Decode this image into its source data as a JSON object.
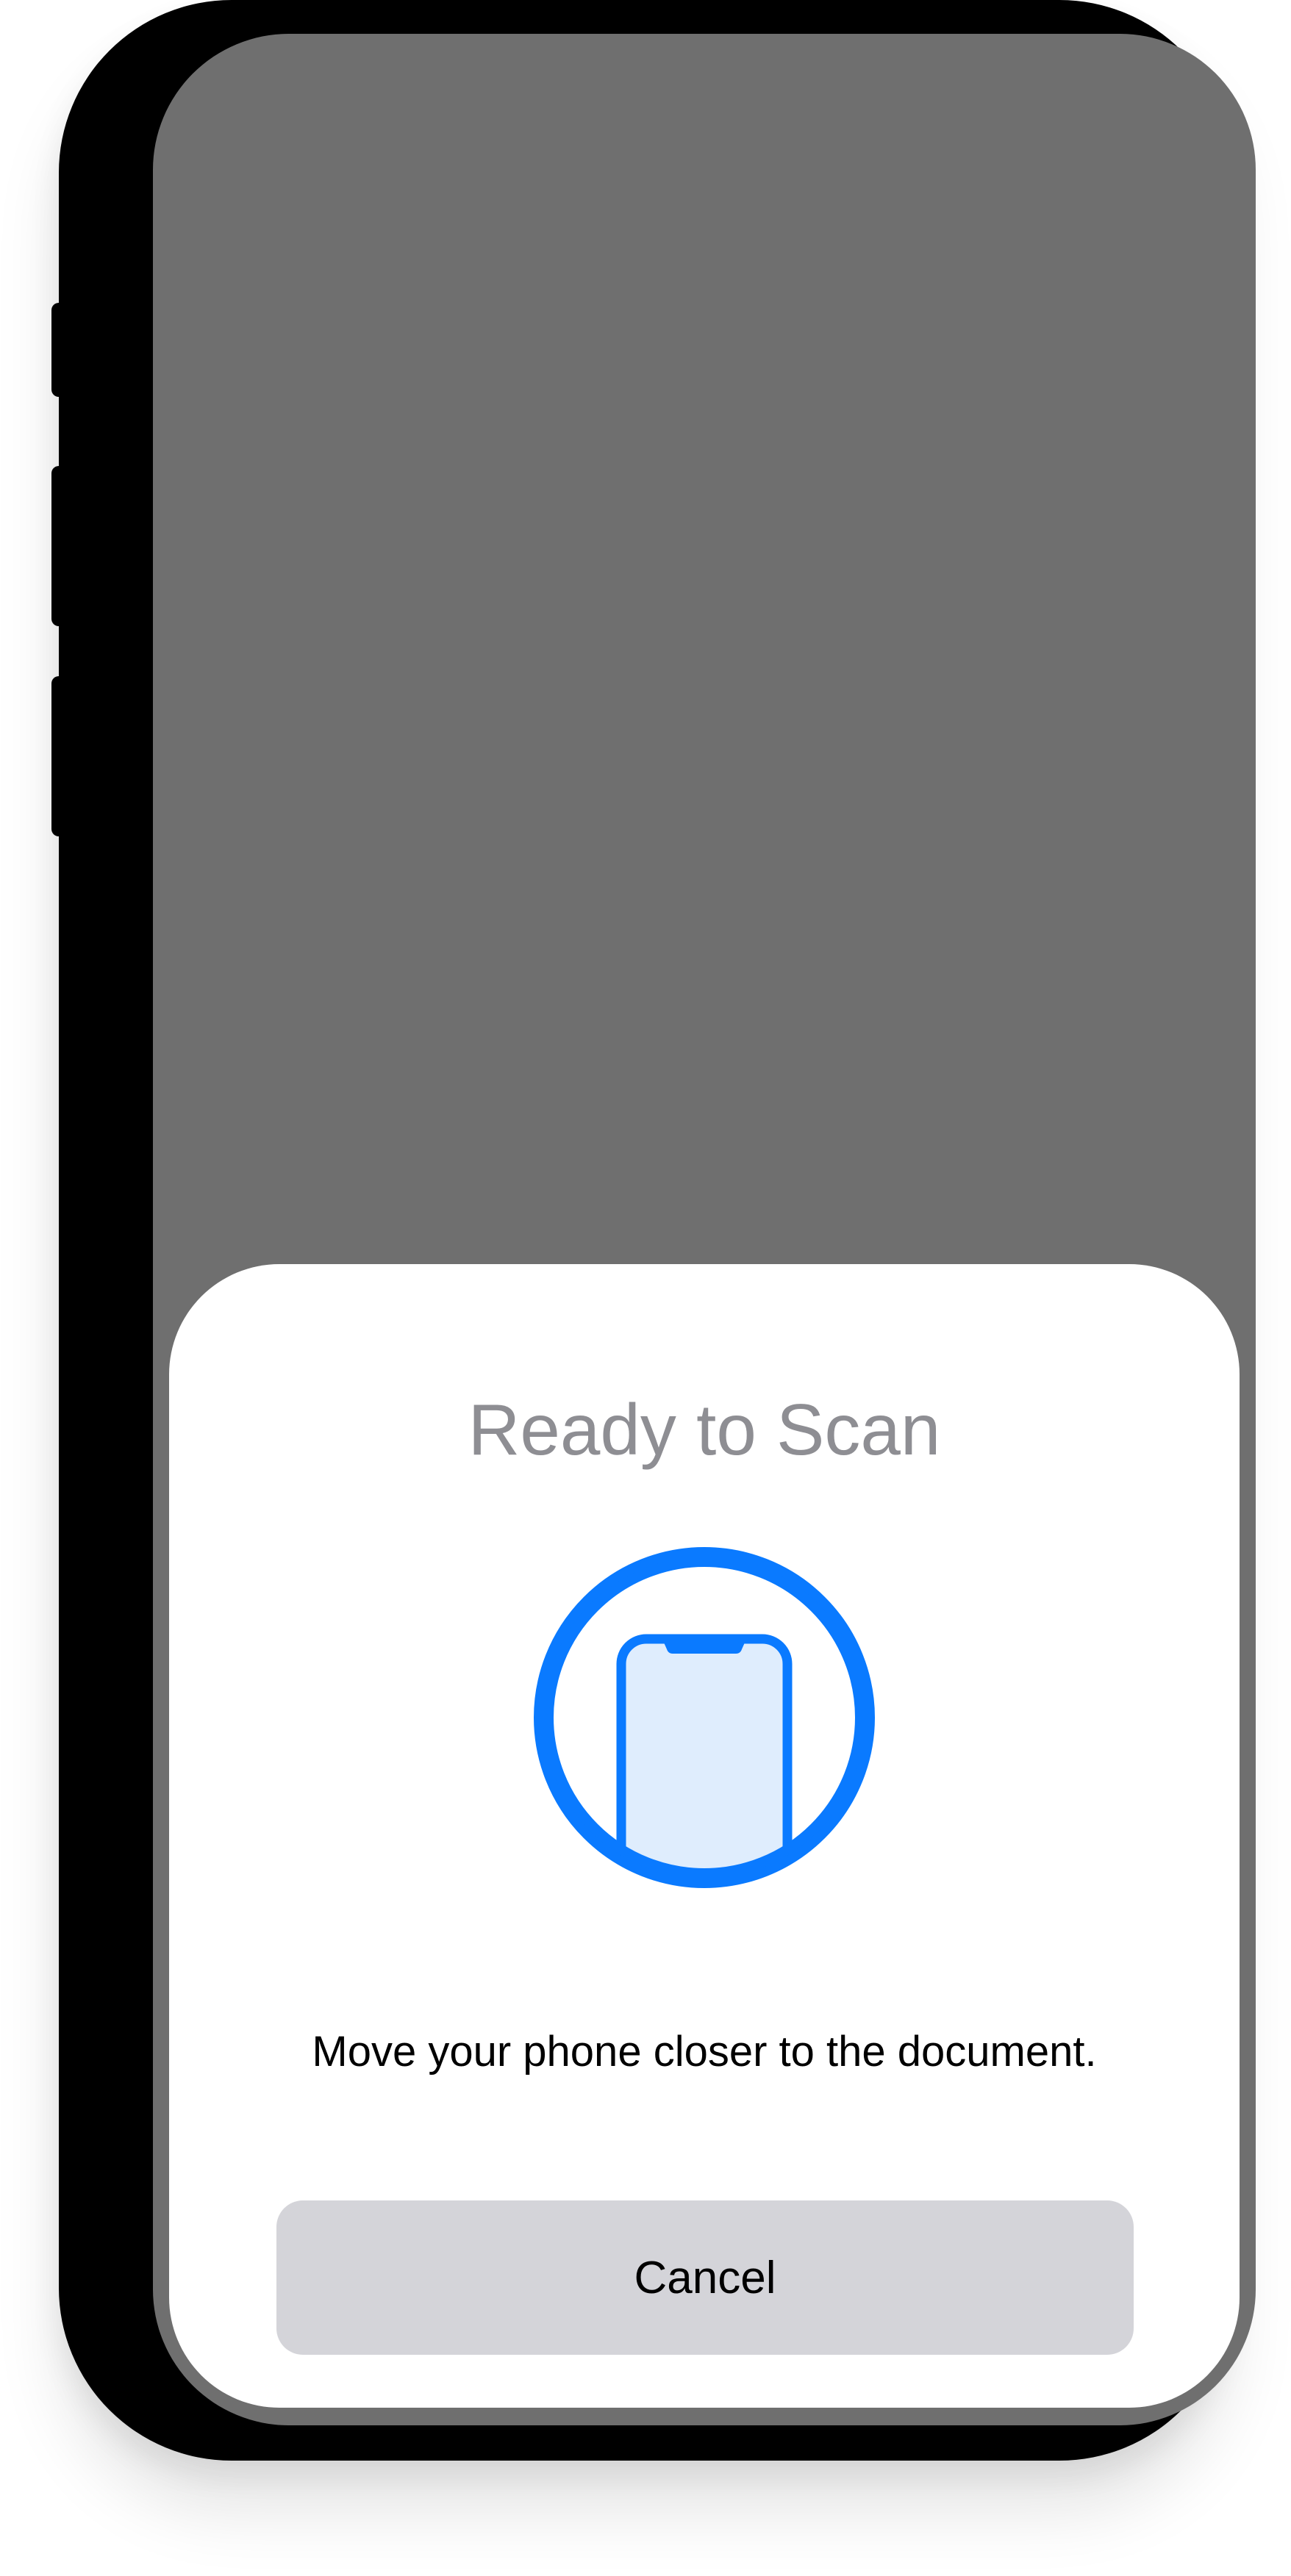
{
  "scan_sheet": {
    "title": "Ready to Scan",
    "illustration_icon": "phone-scan-icon",
    "message": "Move your phone closer to the document.",
    "cancel_label": "Cancel"
  },
  "colors": {
    "accent": "#0a7aff",
    "illustration_fill": "#dfedfd",
    "title_text": "#8e8e93",
    "button_background": "#d4d4d9",
    "screen_background": "#6f6f6f"
  }
}
